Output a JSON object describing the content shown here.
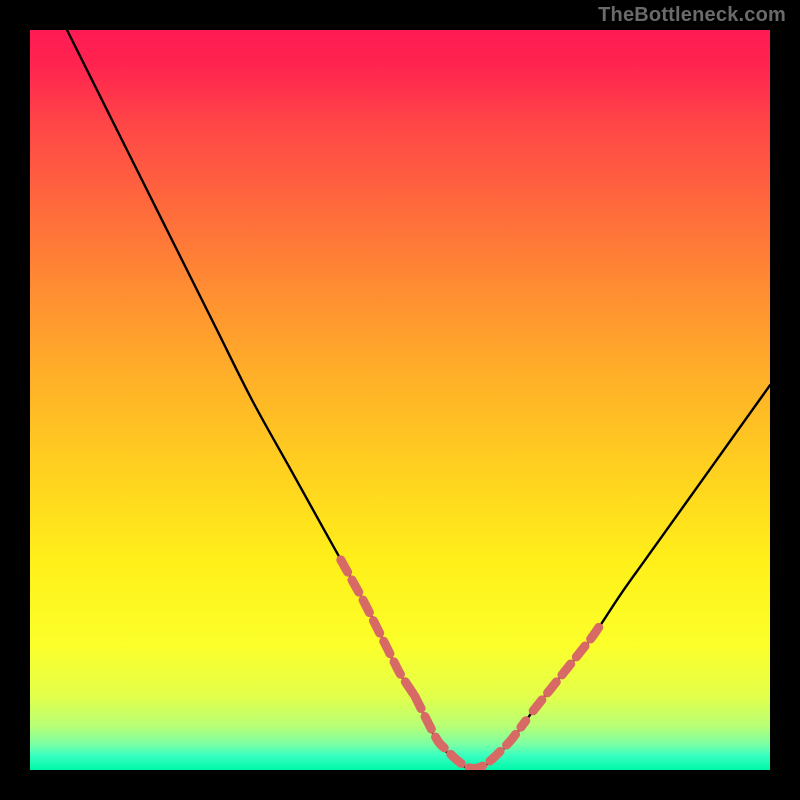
{
  "watermark": "TheBottleneck.com",
  "colors": {
    "page_bg": "#000000",
    "watermark_text": "#6a6a6a",
    "curve_stroke": "#000000",
    "highlight_stroke": "#d86a66",
    "gradient_stops": [
      {
        "offset": 0.0,
        "color": "#ff1a53"
      },
      {
        "offset": 0.05,
        "color": "#ff254f"
      },
      {
        "offset": 0.13,
        "color": "#ff4747"
      },
      {
        "offset": 0.24,
        "color": "#ff6a3c"
      },
      {
        "offset": 0.35,
        "color": "#ff8d32"
      },
      {
        "offset": 0.47,
        "color": "#ffb028"
      },
      {
        "offset": 0.6,
        "color": "#ffd21f"
      },
      {
        "offset": 0.72,
        "color": "#fff01a"
      },
      {
        "offset": 0.83,
        "color": "#fcff2a"
      },
      {
        "offset": 0.9,
        "color": "#e3ff4a"
      },
      {
        "offset": 0.94,
        "color": "#b8ff75"
      },
      {
        "offset": 0.965,
        "color": "#7cffa3"
      },
      {
        "offset": 0.98,
        "color": "#39ffc0"
      },
      {
        "offset": 1.0,
        "color": "#00f8a8"
      }
    ]
  },
  "chart_data": {
    "type": "line",
    "title": "",
    "xlabel": "",
    "ylabel": "",
    "xlim": [
      0,
      100
    ],
    "ylim": [
      0,
      100
    ],
    "grid": false,
    "legend": false,
    "description": "V-shaped bottleneck curve. Vertical axis encodes bottleneck percentage (0% at bottom/green, 100% at top/red). Minimum (0%) sits at roughly x≈55–62. Left arm rises to 100% at x≈5; right arm rises to ~52% at x=100.",
    "series": [
      {
        "name": "bottleneck_pct",
        "x": [
          5,
          10,
          15,
          20,
          25,
          30,
          35,
          40,
          45,
          48,
          50,
          52,
          55,
          58,
          60,
          62,
          65,
          68,
          72,
          76,
          80,
          85,
          90,
          95,
          100
        ],
        "y": [
          100,
          90,
          80,
          70,
          60,
          50,
          41,
          32,
          23,
          17,
          13,
          10,
          4,
          1,
          0,
          1,
          4,
          8,
          13,
          18,
          24,
          31,
          38,
          45,
          52
        ]
      }
    ],
    "highlight_segments": {
      "description": "Dashed salmon marker ranges along the curve near the trough and just above it on both arms.",
      "x_ranges": [
        [
          42,
          52
        ],
        [
          52,
          67
        ],
        [
          68,
          77
        ]
      ]
    }
  }
}
